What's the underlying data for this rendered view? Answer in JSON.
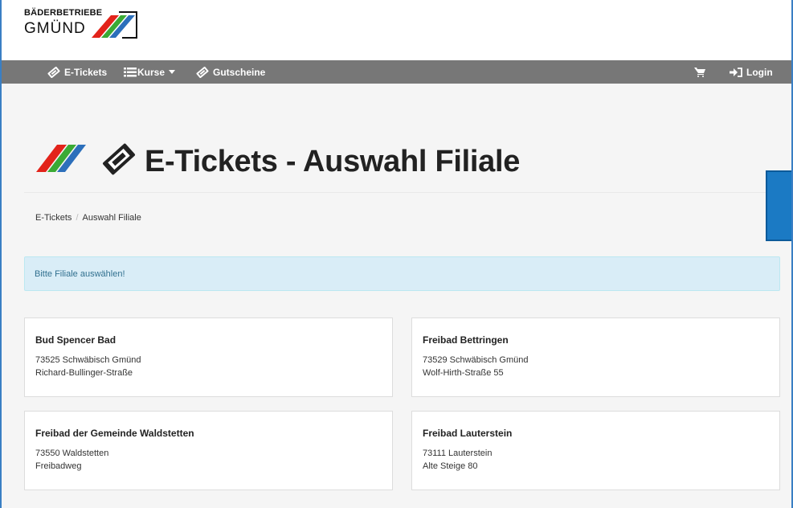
{
  "brand": {
    "line1": "BÄDERBETRIEBE",
    "line2": "GMÜND",
    "logo_colors": [
      "#e2231a",
      "#3aaa35",
      "#2c6fbb"
    ]
  },
  "nav": {
    "items": [
      {
        "label": "E-Tickets",
        "icon": "ticket-icon"
      },
      {
        "label": "Kurse",
        "icon": "list-icon",
        "dropdown": true
      },
      {
        "label": "Gutscheine",
        "icon": "ticket-icon"
      }
    ],
    "cart_icon": "cart-icon",
    "login_label": "Login"
  },
  "page": {
    "title": "E-Tickets - Auswahl Filiale"
  },
  "breadcrumb": [
    "E-Tickets",
    "Auswahl Filiale"
  ],
  "alert": "Bitte Filiale auswählen!",
  "branches": [
    {
      "name": "Bud Spencer Bad",
      "city": "73525 Schwäbisch Gmünd",
      "street": "Richard-Bullinger-Straße"
    },
    {
      "name": "Freibad Bettringen",
      "city": "73529 Schwäbisch Gmünd",
      "street": "Wolf-Hirth-Straße 55"
    },
    {
      "name": "Freibad der Gemeinde Waldstetten",
      "city": "73550 Waldstetten",
      "street": "Freibadweg"
    },
    {
      "name": "Freibad Lauterstein",
      "city": "73111 Lauterstein",
      "street": "Alte Steige 80"
    }
  ]
}
